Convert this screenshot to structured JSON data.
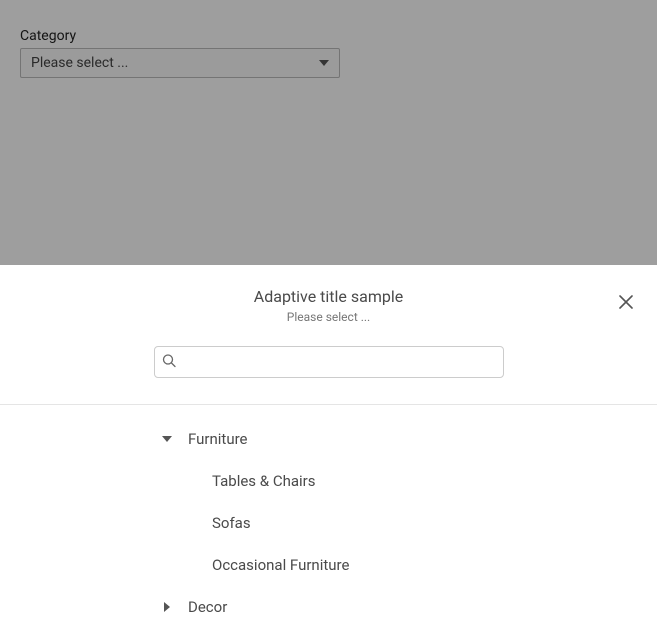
{
  "backdrop": {
    "field_label": "Category",
    "select_placeholder": "Please select ..."
  },
  "modal": {
    "title": "Adaptive title sample",
    "subtitle": "Please select ...",
    "search_placeholder": "",
    "tree": [
      {
        "label": "Furniture",
        "expanded": true,
        "children": [
          {
            "label": "Tables & Chairs"
          },
          {
            "label": "Sofas"
          },
          {
            "label": "Occasional Furniture"
          }
        ]
      },
      {
        "label": "Decor",
        "expanded": false
      }
    ]
  }
}
